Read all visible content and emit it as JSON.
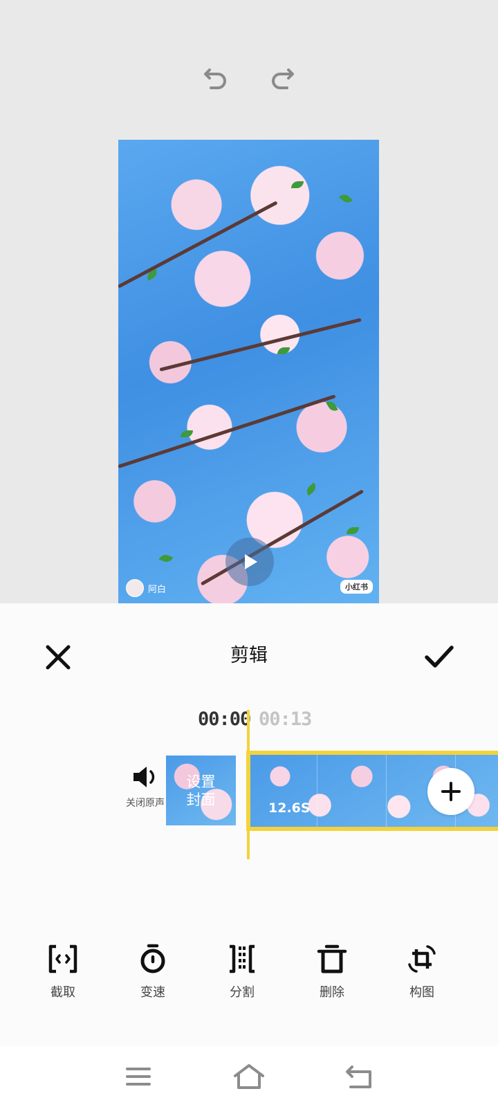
{
  "editor": {
    "title": "剪辑",
    "time_current": "00:00",
    "time_total": "00:13",
    "mute_label": "关闭原声",
    "cover_label": "设置封面",
    "clip_duration": "12.6S"
  },
  "video": {
    "watermark_user": "阿白",
    "watermark_brand": "小红书"
  },
  "tools": [
    {
      "label": "截取",
      "icon": "trim-icon"
    },
    {
      "label": "变速",
      "icon": "speed-icon"
    },
    {
      "label": "分割",
      "icon": "split-icon"
    },
    {
      "label": "删除",
      "icon": "delete-icon"
    },
    {
      "label": "构图",
      "icon": "compose-icon"
    }
  ],
  "colors": {
    "accent": "#f2d33c",
    "sheet_bg": "#fbfbfb",
    "preview_bg": "#e9e9e9"
  }
}
